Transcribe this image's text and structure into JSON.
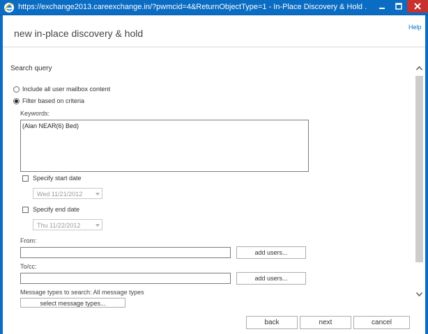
{
  "window": {
    "title": "https://exchange2013.careexchange.in/?pwmcid=4&ReturnObjectType=1 - In-Place Discovery & Hold ...",
    "icon": "ie-icon",
    "controls": [
      "minimize-icon",
      "maximize-icon",
      "close-icon"
    ]
  },
  "header": {
    "help": "Help",
    "title": "new in-place discovery & hold"
  },
  "search_query": {
    "section_title": "Search query",
    "option_all": "Include all user mailbox content",
    "option_filter": "Filter based on criteria",
    "selected": "Filter based on criteria",
    "keywords_label": "Keywords:",
    "keywords_value": "(Alan NEAR(6) Bed)",
    "start_date_label": "Specify start date",
    "start_date_value": "Wed 11/21/2012",
    "start_date_checked": false,
    "end_date_label": "Specify end date",
    "end_date_value": "Thu 11/22/2012",
    "end_date_checked": false,
    "from_label": "From:",
    "from_value": "",
    "from_add_button": "add users...",
    "tocc_label": "To/cc:",
    "tocc_value": "",
    "tocc_add_button": "add users...",
    "message_types_label": "Message types to search: All message types",
    "select_types_button": "select message types..."
  },
  "footer": {
    "back": "back",
    "next": "next",
    "cancel": "cancel"
  },
  "colors": {
    "titlebar": "#0a6cc2",
    "close": "#c7312e",
    "link": "#0072c6"
  }
}
